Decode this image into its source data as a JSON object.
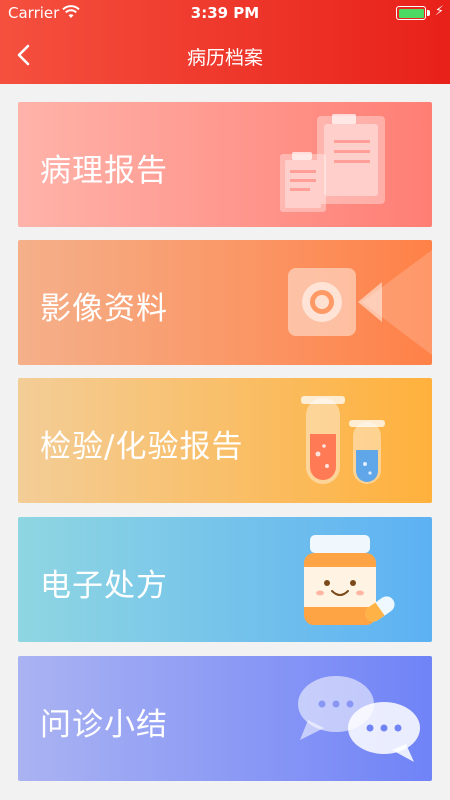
{
  "status_bar": {
    "carrier": "Carrier",
    "time": "3:39 PM",
    "battery_color": "#4cd964"
  },
  "nav": {
    "title": "病历档案",
    "back_icon": "chevron-left-icon"
  },
  "colors": {
    "header_start": "#f5503f",
    "header_end": "#e8211a",
    "background": "#f2f2f2"
  },
  "cards": [
    {
      "label": "病理报告",
      "icon": "documents-icon"
    },
    {
      "label": "影像资料",
      "icon": "video-camera-icon"
    },
    {
      "label": "检验/化验报告",
      "icon": "test-tubes-icon"
    },
    {
      "label": "电子处方",
      "icon": "medicine-bottle-icon"
    },
    {
      "label": "问诊小结",
      "icon": "chat-bubbles-icon"
    }
  ]
}
